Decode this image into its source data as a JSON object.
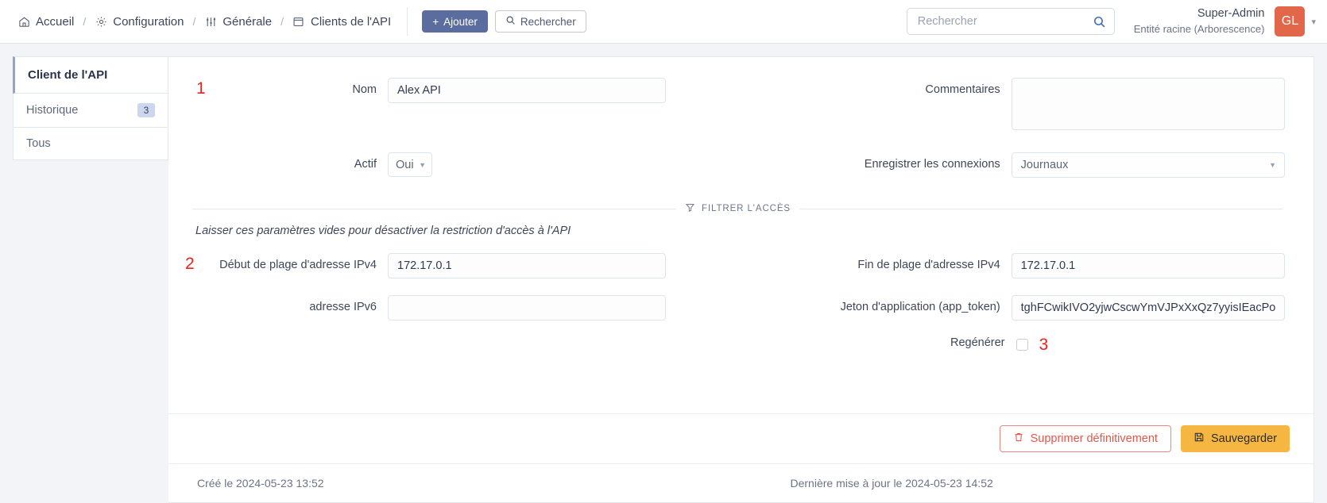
{
  "breadcrumb": {
    "items": [
      {
        "label": "Accueil",
        "icon": "home-icon"
      },
      {
        "label": "Configuration",
        "icon": "gear-icon"
      },
      {
        "label": "Générale",
        "icon": "sliders-icon"
      },
      {
        "label": "Clients de l'API",
        "icon": "window-icon"
      }
    ],
    "separator": "/",
    "add_label": "Ajouter",
    "add_icon": "plus-icon",
    "search_label": "Rechercher",
    "search_icon": "search-icon"
  },
  "header": {
    "search": {
      "placeholder": "Rechercher",
      "value": "",
      "icon": "search-icon"
    },
    "user": {
      "name": "Super-Admin",
      "entity": "Entité racine (Arborescence)",
      "initials": "GL",
      "caret_icon": "chevron-down-icon",
      "avatar_color": "#e2664a"
    }
  },
  "sidebar": {
    "title": "Client de l'API",
    "items": [
      {
        "label": "Historique",
        "badge": "3"
      },
      {
        "label": "Tous",
        "badge": ""
      }
    ]
  },
  "form": {
    "name": {
      "label": "Nom",
      "value": "Alex API",
      "marker": "1"
    },
    "actif": {
      "label": "Actif",
      "value": "Oui",
      "caret_icon": "chevron-down-icon"
    },
    "commentaires": {
      "label": "Commentaires",
      "value": "",
      "placeholder": ""
    },
    "log_connections": {
      "label": "Enregistrer les connexions",
      "value": "Journaux",
      "caret_icon": "chevron-down-icon"
    },
    "section_divider": {
      "label": "FILTRER L'ACCÈS",
      "icon": "filter-icon"
    },
    "hint": "Laisser ces paramètres vides pour désactiver la restriction d'accès à l'API",
    "ipv4_start": {
      "label": "Début de plage d'adresse IPv4",
      "value": "172.17.0.1",
      "marker": "2"
    },
    "ipv4_end": {
      "label": "Fin de plage d'adresse IPv4",
      "value": "172.17.0.1"
    },
    "ipv6": {
      "label": "adresse IPv6",
      "value": "",
      "placeholder": ""
    },
    "app_token": {
      "label": "Jeton d'application (app_token)",
      "value": "tghFCwikIVO2yjwCscwYmVJPxXxQz7yyisIEacPo"
    },
    "regenerate": {
      "label": "Regénérer",
      "checked": false,
      "marker": "3"
    }
  },
  "actions": {
    "delete_label": "Supprimer définitivement",
    "delete_icon": "trash-icon",
    "save_label": "Sauvegarder",
    "save_icon": "save-icon"
  },
  "footer": {
    "created": "Créé le 2024-05-23 13:52",
    "updated": "Dernière mise à jour le 2024-05-23 14:52"
  }
}
